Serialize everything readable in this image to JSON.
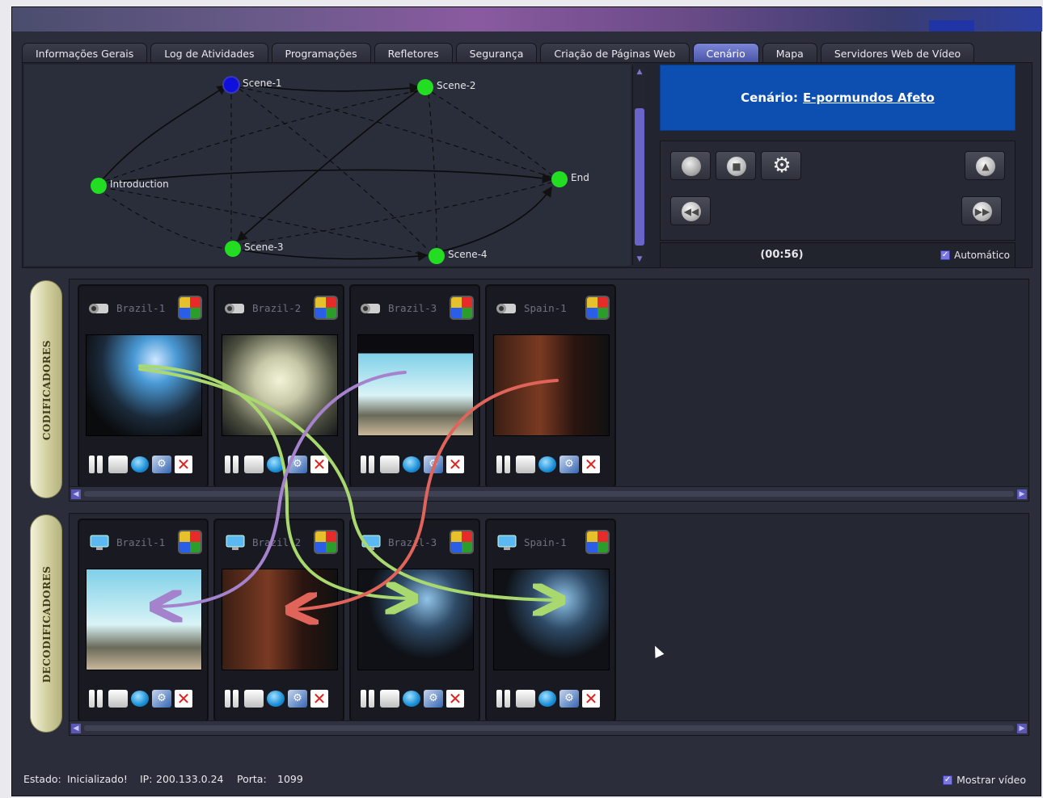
{
  "tabs": [
    {
      "label": "Informações Gerais",
      "active": false
    },
    {
      "label": "Log de Atividades",
      "active": false
    },
    {
      "label": "Programações",
      "active": false
    },
    {
      "label": "Refletores",
      "active": false
    },
    {
      "label": "Segurança",
      "active": false
    },
    {
      "label": "Criação de Páginas Web",
      "active": false
    },
    {
      "label": "Cenário",
      "active": true
    },
    {
      "label": "Mapa",
      "active": false
    },
    {
      "label": "Servidores Web de Vídeo",
      "active": false
    }
  ],
  "graph": {
    "nodes": [
      "Scene-1",
      "Scene-2",
      "Introduction",
      "End",
      "Scene-3",
      "Scene-4"
    ]
  },
  "scenario": {
    "label": "Cenário:",
    "name": "E-pormundos Afeto",
    "timer": "(00:56)",
    "auto_label": "Automático",
    "auto_checked": true
  },
  "encoders": {
    "section_label": "CODIFICADORES",
    "cards": [
      {
        "name": "Brazil-1",
        "icon": "camera-icon"
      },
      {
        "name": "Brazil-2",
        "icon": "camera-icon"
      },
      {
        "name": "Brazil-3",
        "icon": "camera-icon"
      },
      {
        "name": "Spain-1",
        "icon": "camera-icon"
      }
    ]
  },
  "decoders": {
    "section_label": "DECODIFICADORES",
    "cards": [
      {
        "name": "Brazil-1",
        "icon": "monitor-icon"
      },
      {
        "name": "Brazil-2",
        "icon": "monitor-icon"
      },
      {
        "name": "Brazil-3",
        "icon": "monitor-icon"
      },
      {
        "name": "Spain-1",
        "icon": "monitor-icon"
      }
    ]
  },
  "status": {
    "estado_label": "Estado:",
    "estado_value": "Inicializado!",
    "ip_label": "IP:",
    "ip_value": "200.133.0.24",
    "porta_label": "Porta:",
    "porta_value": "1099",
    "mostrar_label": "Mostrar vídeo",
    "mostrar_checked": true
  },
  "colors": {
    "accent": "#0d4fb0",
    "node_green": "#22dd22",
    "node_blue": "#1010dd",
    "route_green": "#a9d86e",
    "route_purple": "#a583cc",
    "route_red": "#e0645a"
  }
}
